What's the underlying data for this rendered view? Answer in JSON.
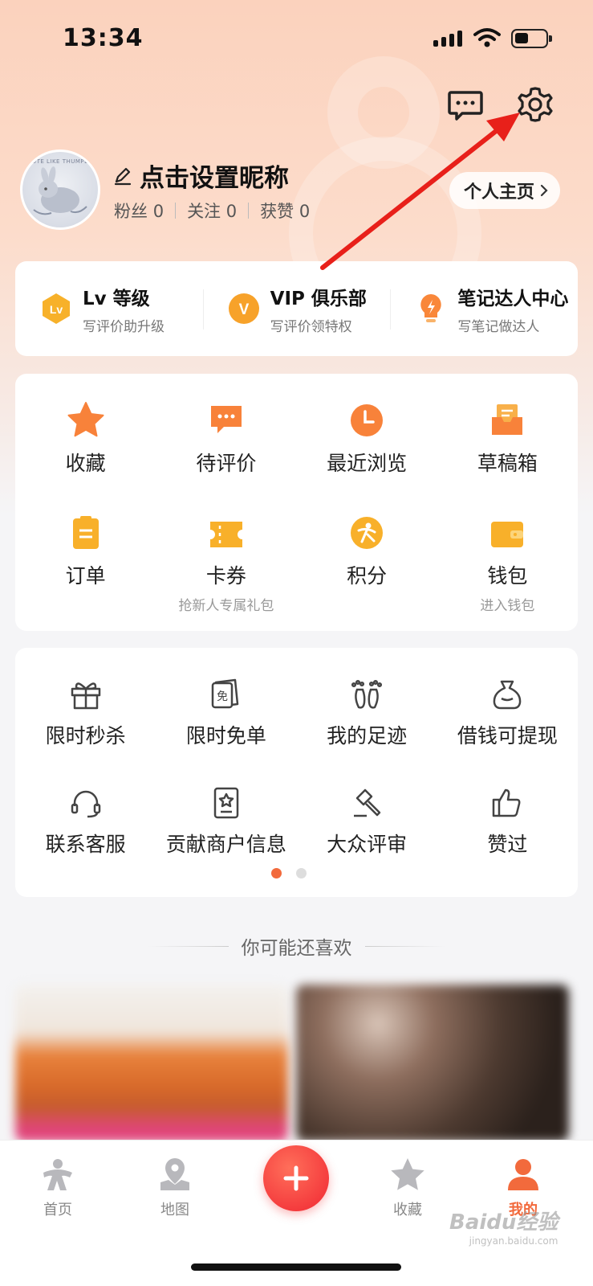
{
  "status_bar": {
    "time": "13:34"
  },
  "profile": {
    "nickname": "点击设置昵称",
    "stats": [
      {
        "label": "粉丝",
        "value": "0"
      },
      {
        "label": "关注",
        "value": "0"
      },
      {
        "label": "获赞",
        "value": "0"
      }
    ],
    "homepage_button": "个人主页",
    "avatar_text": "CUTE LIKE THUMPER"
  },
  "level_card": [
    {
      "title": "Lv 等级",
      "subtitle": "写评价助升级",
      "icon": "lv-badge-icon"
    },
    {
      "title": "VIP 俱乐部",
      "subtitle": "写评价领特权",
      "icon": "vip-badge-icon"
    },
    {
      "title": "笔记达人中心",
      "subtitle": "写笔记做达人",
      "icon": "lightbulb-icon"
    }
  ],
  "main_grid": [
    {
      "label": "收藏",
      "sub": "",
      "icon": "star-icon"
    },
    {
      "label": "待评价",
      "sub": "",
      "icon": "comment-icon"
    },
    {
      "label": "最近浏览",
      "sub": "",
      "icon": "clock-icon"
    },
    {
      "label": "草稿箱",
      "sub": "",
      "icon": "drafts-icon"
    },
    {
      "label": "订单",
      "sub": "",
      "icon": "order-icon"
    },
    {
      "label": "卡券",
      "sub": "抢新人专属礼包",
      "icon": "coupon-icon"
    },
    {
      "label": "积分",
      "sub": "",
      "icon": "points-icon"
    },
    {
      "label": "钱包",
      "sub": "进入钱包",
      "icon": "wallet-icon"
    }
  ],
  "service_grid": [
    {
      "label": "限时秒杀",
      "icon": "gift-icon"
    },
    {
      "label": "限时免单",
      "icon": "free-ticket-icon",
      "icon_text": "免"
    },
    {
      "label": "我的足迹",
      "icon": "footprint-icon"
    },
    {
      "label": "借钱可提现",
      "icon": "money-bag-icon"
    },
    {
      "label": "联系客服",
      "icon": "headset-icon"
    },
    {
      "label": "贡献商户信息",
      "icon": "merchant-info-icon"
    },
    {
      "label": "大众评审",
      "icon": "gavel-icon"
    },
    {
      "label": "赞过",
      "icon": "thumbs-up-icon"
    }
  ],
  "pagination": {
    "current": 1,
    "total": 2
  },
  "recommend_title": "你可能还喜欢",
  "tabbar": [
    {
      "label": "首页",
      "icon": "home-logo-icon",
      "active": false
    },
    {
      "label": "地图",
      "icon": "map-pin-icon",
      "active": false
    },
    {
      "label": "",
      "icon": "plus-icon",
      "active": false
    },
    {
      "label": "收藏",
      "icon": "star-icon",
      "active": false
    },
    {
      "label": "我的",
      "icon": "person-icon",
      "active": true
    }
  ],
  "watermark": {
    "text": "Baidu经验",
    "sub": "jingyan.baidu.com"
  },
  "colors": {
    "accent": "#f26a3c",
    "orange": "#f8983a",
    "red": "#f4393c",
    "annotation_arrow": "#e8201a"
  }
}
